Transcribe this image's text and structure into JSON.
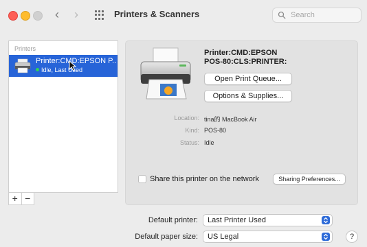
{
  "window": {
    "title": "Printers & Scanners",
    "search_placeholder": "Search"
  },
  "printers": {
    "header": "Printers",
    "items": [
      {
        "name": "Printer:CMD:EPSON P...",
        "status": "Idle, Last Used",
        "status_color": "#30d158",
        "selected": true
      }
    ],
    "add_label": "+",
    "remove_label": "−"
  },
  "detail": {
    "name_line1": "Printer:CMD:EPSON",
    "name_line2": "POS-80:CLS:PRINTER:",
    "open_queue_label": "Open Print Queue...",
    "options_label": "Options & Supplies...",
    "location_label": "Location:",
    "location_value": "tina的 MacBook Air",
    "kind_label": "Kind:",
    "kind_value": "POS-80",
    "status_label": "Status:",
    "status_value": "Idle",
    "share_label": "Share this printer on the network",
    "share_checked": false,
    "sharing_prefs_label": "Sharing Preferences..."
  },
  "footer": {
    "default_printer_label": "Default printer:",
    "default_printer_value": "Last Printer Used",
    "paper_size_label": "Default paper size:",
    "paper_size_value": "US Legal",
    "help_label": "?"
  },
  "colors": {
    "accent": "#2764d8",
    "close": "#fe5f57",
    "minimize": "#febc2e",
    "zoom_disabled": "#d0d0d0"
  }
}
